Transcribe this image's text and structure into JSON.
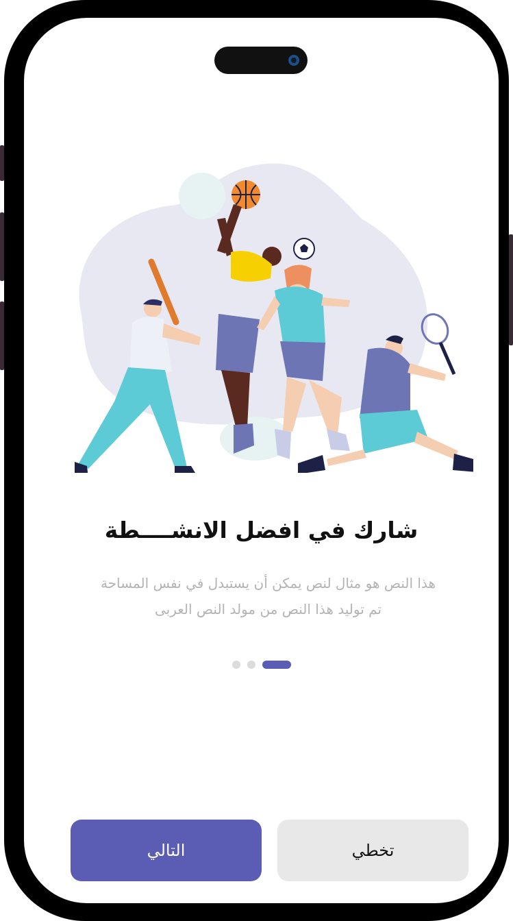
{
  "onboarding": {
    "title": "شارك في افضل الانشــــطة",
    "description_line1": "هذا النص هو مثال لنص يمكن أن يستبدل في نفس المساحة",
    "description_line2": "تم توليد هذا النص من مولد النص العربى",
    "page_indicator": {
      "total": 3,
      "active": 3
    }
  },
  "buttons": {
    "next_label": "التالي",
    "skip_label": "تخطي"
  },
  "colors": {
    "accent": "#5b5cb3",
    "skip_bg": "#e8e8e8",
    "blob": "#e8e8f3",
    "teal": "#5ccbd6",
    "navy": "#6d75b5"
  },
  "illustration": {
    "icon": "sports-players-illustration"
  }
}
